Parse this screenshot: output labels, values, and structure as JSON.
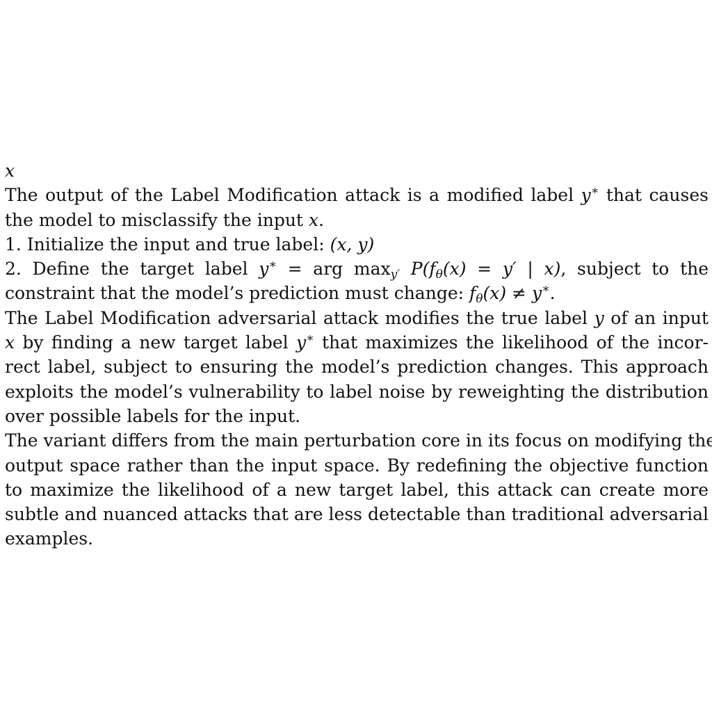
{
  "document": {
    "var_line": "x",
    "para1": {
      "l1": {
        "before": "The output of the Label Modification attack is a modified label ",
        "math": "y",
        "sup": "∗",
        "after": " that causes"
      },
      "l2": {
        "before": "the model to misclassify the input ",
        "math": "x",
        "after": "."
      }
    },
    "step1": {
      "before": "1. Initialize the input and true label: ",
      "math": "(x, y)"
    },
    "step2": {
      "l1": {
        "before": "2.  Define the target label ",
        "y": "y",
        "sup": "∗",
        "eq": " = ",
        "argmax": "arg max",
        "sub": "y′",
        "p": " P(f",
        "theta": "θ",
        "rest": "(x) = y′ | x)",
        "after": ", subject to the"
      },
      "l2": {
        "before": "constraint that the model’s prediction must change: ",
        "f": "f",
        "theta": "θ",
        "rest": "(x) ≠ y",
        "sup": "∗",
        "after": "."
      }
    },
    "para2": {
      "l1": {
        "before": "The Label Modification adversarial attack modifies the true label ",
        "y": "y",
        "after": " of an input"
      },
      "l2": {
        "x": "x",
        "before": " by finding a new target label ",
        "y": "y",
        "sup": "∗",
        "after": " that maximizes the likelihood of the incor-"
      },
      "l3": "rect label, subject to ensuring the model’s prediction changes. This approach",
      "l4": "exploits the model’s vulnerability to label noise by reweighting the distribution",
      "l5": "over possible labels for the input."
    },
    "para3": {
      "l1": "The variant differs from the main perturbation core in its focus on modifying the",
      "l2": "output space rather than the input space. By redefining the objective function",
      "l3": "to maximize the likelihood of a new target label, this attack can create more",
      "l4": "subtle and nuanced attacks that are less detectable than traditional adversarial",
      "l5": "examples."
    }
  }
}
